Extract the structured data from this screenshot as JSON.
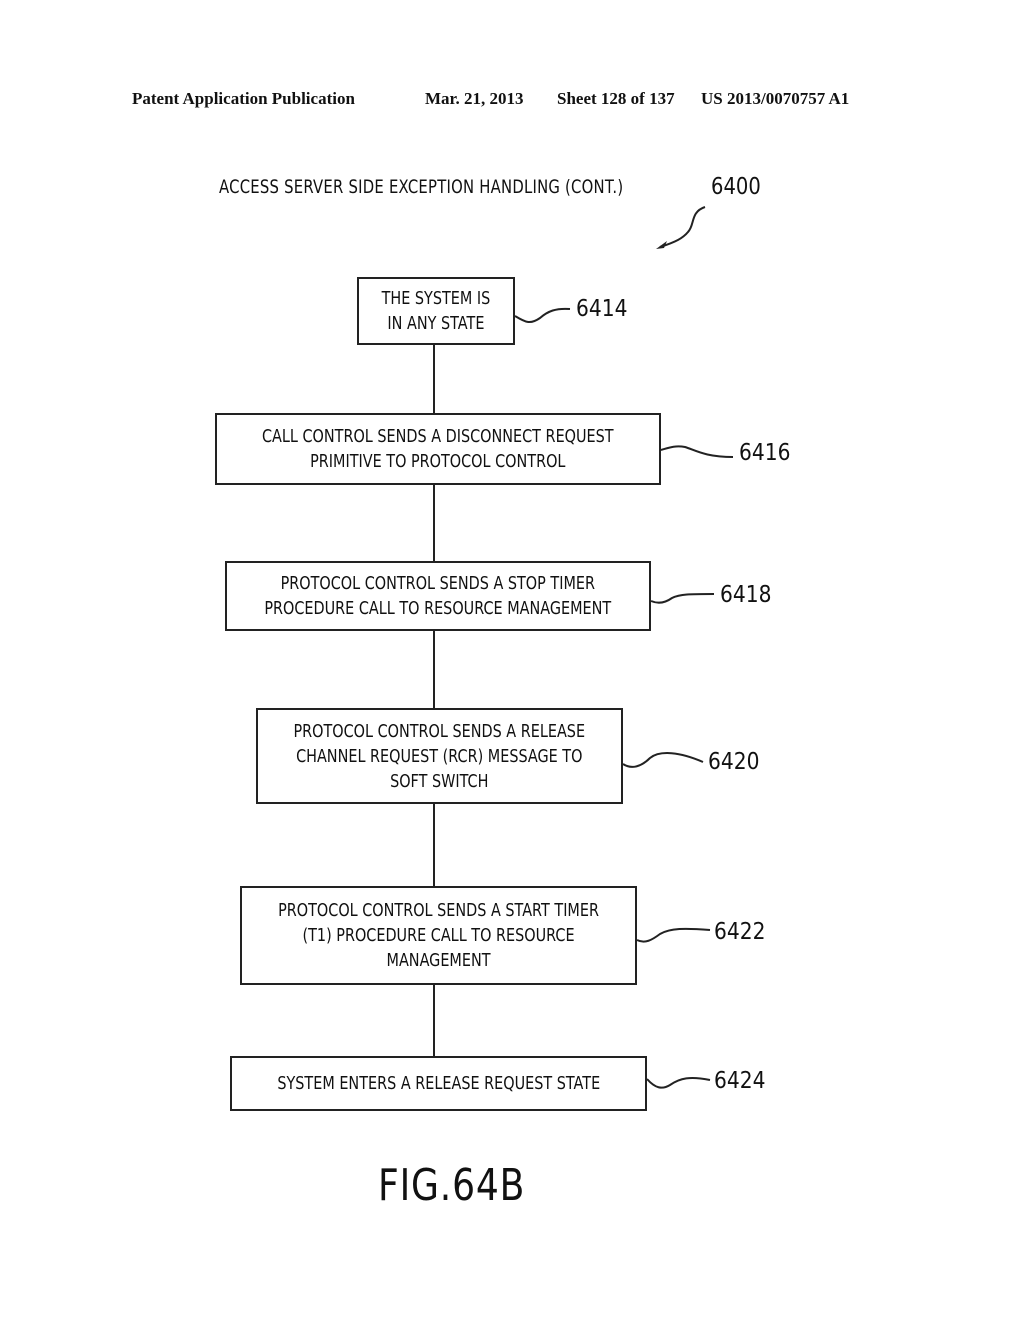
{
  "header": {
    "publication": "Patent Application Publication",
    "date": "Mar. 21, 2013",
    "sheet": "Sheet 128 of 137",
    "number": "US 2013/0070757 A1"
  },
  "diagram": {
    "title": "ACCESS SERVER SIDE EXCEPTION HANDLING (CONT.)",
    "reference": "6400",
    "figure_label": "FIG.64B",
    "steps": [
      {
        "ref": "6414",
        "text": "THE SYSTEM IS\nIN ANY STATE"
      },
      {
        "ref": "6416",
        "text": "CALL CONTROL SENDS A DISCONNECT REQUEST\nPRIMITIVE TO PROTOCOL CONTROL"
      },
      {
        "ref": "6418",
        "text": "PROTOCOL CONTROL SENDS A STOP TIMER\nPROCEDURE CALL TO RESOURCE MANAGEMENT"
      },
      {
        "ref": "6420",
        "text": "PROTOCOL CONTROL SENDS A RELEASE\nCHANNEL REQUEST (RCR) MESSAGE TO\nSOFT SWITCH"
      },
      {
        "ref": "6422",
        "text": "PROTOCOL CONTROL SENDS A START TIMER\n(T1) PROCEDURE CALL TO RESOURCE\nMANAGEMENT"
      },
      {
        "ref": "6424",
        "text": "SYSTEM ENTERS A RELEASE REQUEST STATE"
      }
    ]
  }
}
